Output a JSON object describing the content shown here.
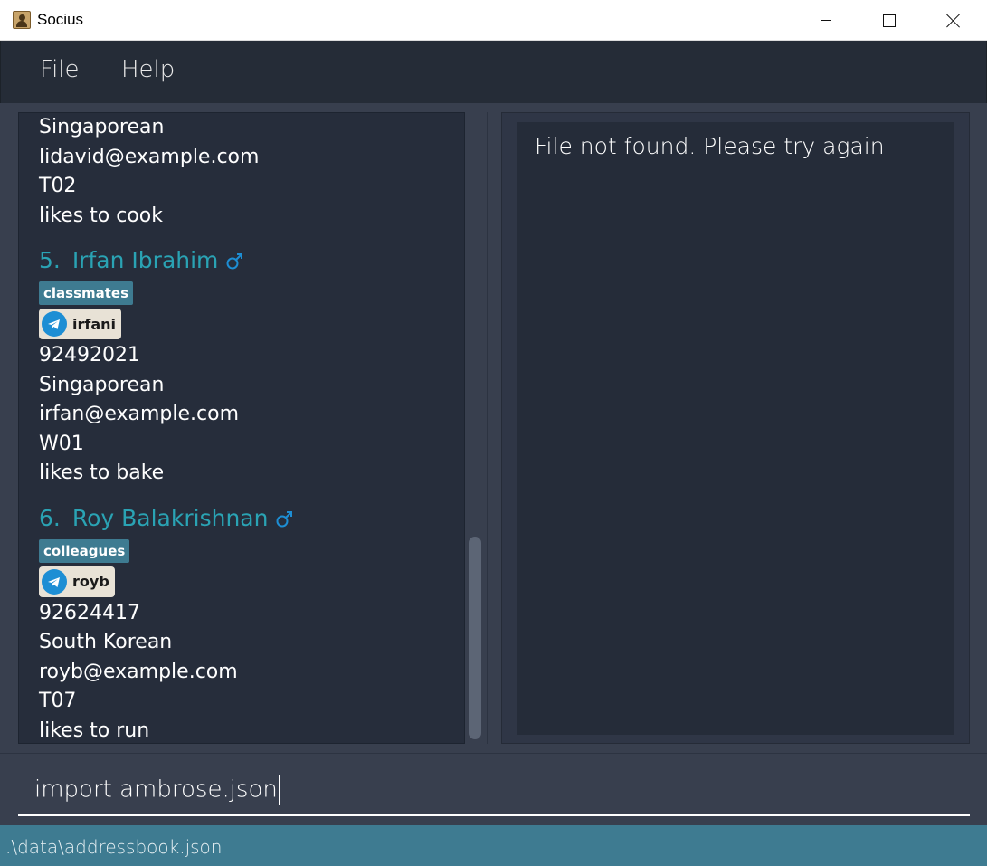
{
  "window": {
    "title": "Socius"
  },
  "menu": {
    "file": "File",
    "help": "Help"
  },
  "list": {
    "partial": {
      "lines": [
        "Singaporean",
        "lidavid@example.com",
        "T02",
        "likes to cook"
      ]
    },
    "cards": [
      {
        "index": "5.",
        "name": "Irfan Ibrahim",
        "gender_icon": "male-icon",
        "tag": "classmates",
        "telegram": "irfani",
        "lines": [
          "92492021",
          "Singaporean",
          "irfan@example.com",
          "W01",
          "likes to bake"
        ]
      },
      {
        "index": "6.",
        "name": "Roy Balakrishnan",
        "gender_icon": "male-icon",
        "tag": "colleagues",
        "telegram": "royb",
        "lines": [
          "92624417",
          "South Korean",
          "royb@example.com",
          "T07",
          "likes to run"
        ]
      }
    ]
  },
  "result": {
    "message": "File not found. Please try again"
  },
  "command": {
    "value": "import ambrose.json"
  },
  "status": {
    "path": ".\\data\\addressbook.json"
  },
  "colors": {
    "accent": "#2aa3b4",
    "tag": "#3e7b91",
    "status_bar": "#3e7b91",
    "telegram": "#1d8ed4",
    "background": "#383f4e"
  }
}
